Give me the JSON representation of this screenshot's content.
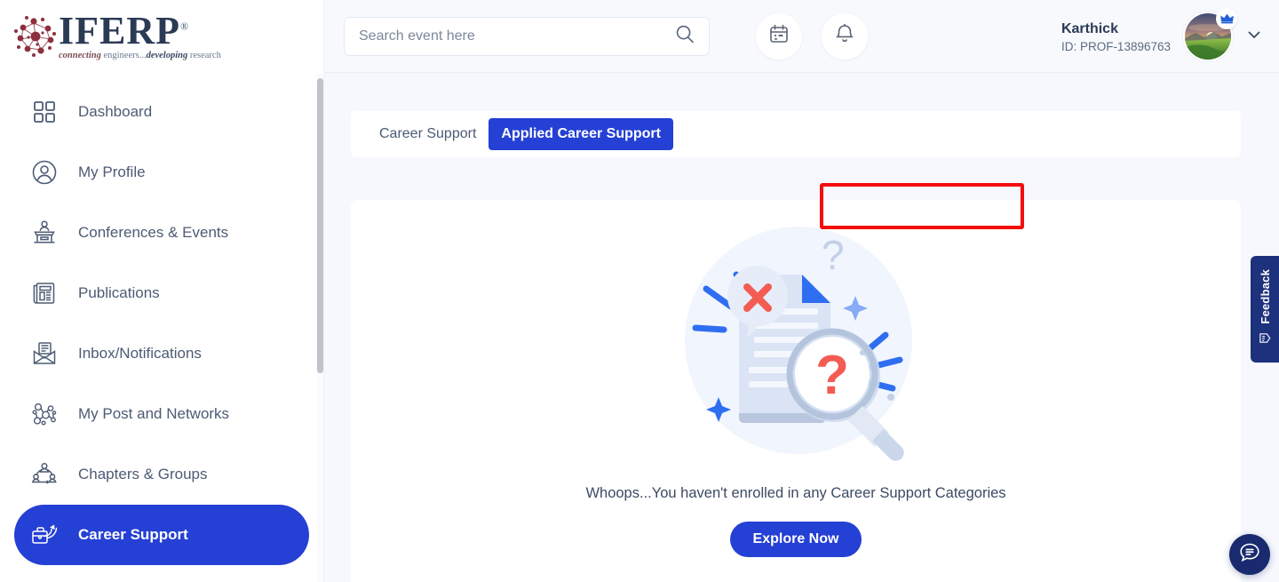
{
  "brand": {
    "name": "IFERP",
    "registered_mark": "®",
    "tagline_part1": "connecting",
    "tagline_part2": " engineers...",
    "tagline_part3": "developing",
    "tagline_part4": " research",
    "logo_icon": "molecule-network-icon"
  },
  "sidebar": {
    "items": [
      {
        "label": "Dashboard",
        "icon": "grid-squares-icon",
        "active": false
      },
      {
        "label": "My Profile",
        "icon": "user-circle-icon",
        "active": false
      },
      {
        "label": "Conferences & Events",
        "icon": "podium-speaker-icon",
        "active": false
      },
      {
        "label": "Publications",
        "icon": "newspaper-icon",
        "active": false
      },
      {
        "label": "Inbox/Notifications",
        "icon": "envelope-open-icon",
        "active": false
      },
      {
        "label": "My Post and Networks",
        "icon": "network-nodes-icon",
        "active": false
      },
      {
        "label": "Chapters & Groups",
        "icon": "people-group-icon",
        "active": false
      },
      {
        "label": "Career Support",
        "icon": "briefcase-career-icon",
        "active": true
      }
    ]
  },
  "topbar": {
    "search": {
      "placeholder": "Search event here",
      "value": "",
      "icon": "search-icon"
    },
    "calendar_icon": "calendar-icon",
    "bell_icon": "bell-notification-icon",
    "user": {
      "name": "Karthick",
      "id": "ID: PROF-13896763",
      "avatar_icon": "landscape-photo-avatar",
      "badge_icon": "crown-icon",
      "dropdown_icon": "chevron-down-icon"
    }
  },
  "content": {
    "tabs": [
      {
        "label": "Career Support",
        "active": false
      },
      {
        "label": "Applied Career Support",
        "active": true
      }
    ],
    "empty_state": {
      "illustration_icon": "document-error-magnifier-illustration",
      "message": "Whoops...You haven't enrolled in any Career Support Categories",
      "cta_label": "Explore Now"
    }
  },
  "widgets": {
    "feedback": {
      "label": "Feedback",
      "icon": "feedback-form-icon"
    },
    "chat": {
      "icon": "chat-bubble-icon"
    }
  },
  "colors": {
    "accent_blue": "#2540d4",
    "navy": "#1e317c",
    "annotation_red": "#f40d0d",
    "page_bg": "#f6f8fd",
    "text_dark": "#2b3a55"
  }
}
